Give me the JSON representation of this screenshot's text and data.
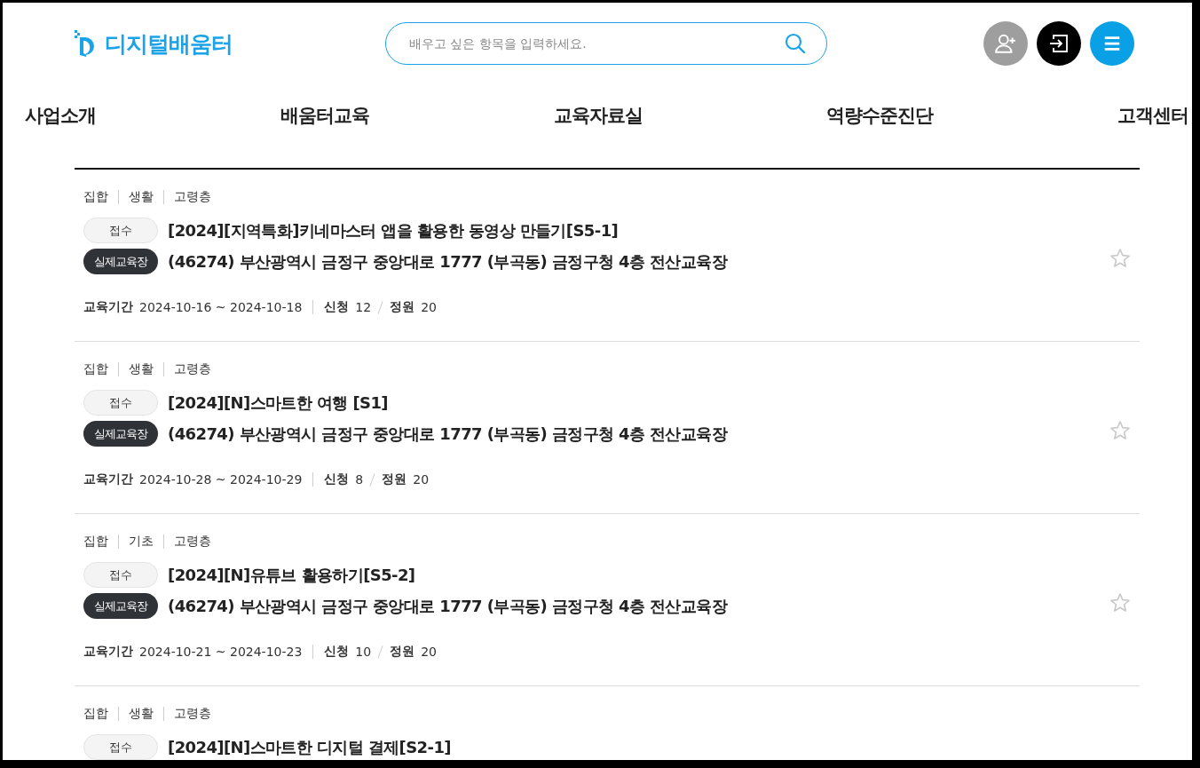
{
  "header": {
    "logo_text": "디지털배움터",
    "search": {
      "placeholder": "배우고 싶은 항목을 입력하세요."
    }
  },
  "nav": [
    "사업소개",
    "배움터교육",
    "교육자료실",
    "역량수준진단",
    "고객센터"
  ],
  "courses": [
    {
      "tags": [
        "집합",
        "생활",
        "고령층"
      ],
      "status": "접수",
      "title": "[2024][지역특화]키네마스터 앱을 활용한 동영상 만들기[S5-1]",
      "location_type": "실제교육장",
      "address": "(46274) 부산광역시 금정구 중앙대로 1777 (부곡동) 금정구청 4층 전산교육장",
      "period_label": "교육기간",
      "period": "2024-10-16 ~ 2024-10-18",
      "applied_label": "신청",
      "applied": "12",
      "capacity_label": "정원",
      "capacity": "20",
      "favorite": false
    },
    {
      "tags": [
        "집합",
        "생활",
        "고령층"
      ],
      "status": "접수",
      "title": "[2024][N]스마트한 여행 [S1]",
      "location_type": "실제교육장",
      "address": "(46274) 부산광역시 금정구 중앙대로 1777 (부곡동) 금정구청 4층 전산교육장",
      "period_label": "교육기간",
      "period": "2024-10-28 ~ 2024-10-29",
      "applied_label": "신청",
      "applied": "8",
      "capacity_label": "정원",
      "capacity": "20",
      "favorite": false
    },
    {
      "tags": [
        "집합",
        "기초",
        "고령층"
      ],
      "status": "접수",
      "title": "[2024][N]유튜브 활용하기[S5-2]",
      "location_type": "실제교육장",
      "address": "(46274) 부산광역시 금정구 중앙대로 1777 (부곡동) 금정구청 4층 전산교육장",
      "period_label": "교육기간",
      "period": "2024-10-21 ~ 2024-10-23",
      "applied_label": "신청",
      "applied": "10",
      "capacity_label": "정원",
      "capacity": "20",
      "favorite": false
    },
    {
      "tags": [
        "집합",
        "생활",
        "고령층"
      ],
      "status": "접수",
      "title": "[2024][N]스마트한 디지털 결제[S2-1]"
    }
  ]
}
